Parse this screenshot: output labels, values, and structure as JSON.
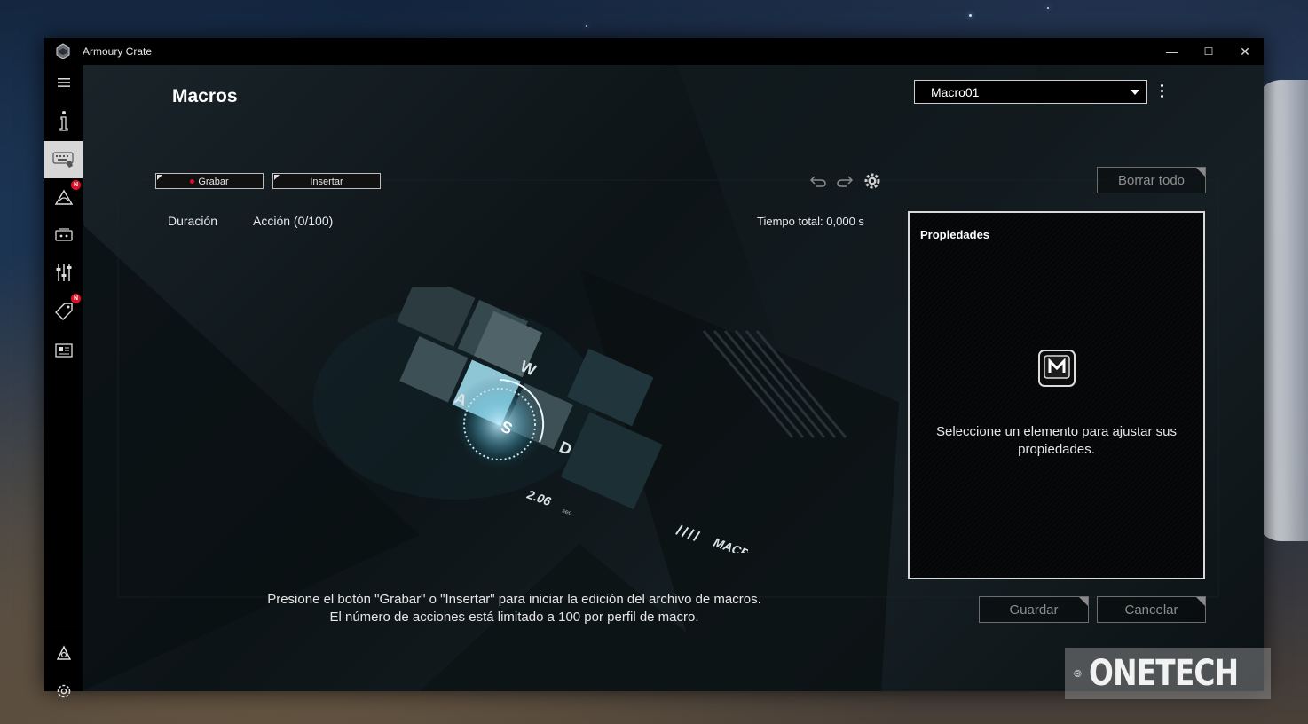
{
  "window": {
    "app_title": "Armoury Crate",
    "controls": {
      "minimize": "—",
      "maximize": "☐",
      "close": "✕"
    }
  },
  "sidebar": {
    "items": [
      {
        "icon": "hamburger-menu-icon"
      },
      {
        "icon": "device-info-icon"
      },
      {
        "icon": "keyboard-macro-icon",
        "active": true
      },
      {
        "icon": "aura-sync-icon",
        "badge": "N"
      },
      {
        "icon": "game-library-icon"
      },
      {
        "icon": "sliders-icon"
      },
      {
        "icon": "deals-tag-icon",
        "badge": "N"
      },
      {
        "icon": "news-icon"
      },
      {
        "icon": "user-center-icon"
      },
      {
        "icon": "settings-gear-icon"
      }
    ]
  },
  "page": {
    "title": "Macros",
    "profile_select": {
      "value": "Macro01"
    }
  },
  "toolbar": {
    "record_label": "Grabar",
    "insert_label": "Insertar",
    "clear_all_label": "Borrar todo"
  },
  "list": {
    "col_duration": "Duración",
    "col_action": "Acción (0/100)",
    "total_time": "Tiempo total: 0,000 s"
  },
  "illustration": {
    "keys": [
      "W",
      "A",
      "S",
      "D"
    ],
    "timer_text": "2.06",
    "timer_unit": "sec",
    "brand_text": "MACROS"
  },
  "properties": {
    "title": "Propiedades",
    "message": "Seleccione un elemento para ajustar sus propiedades."
  },
  "hint": {
    "line1": "Presione el botón  \"Grabar\" o \"Insertar\" para iniciar la edición del archivo de macros.",
    "line2": "El número de acciones está limitado a 100 por perfil de macro."
  },
  "actions": {
    "save_label": "Guardar",
    "cancel_label": "Cancelar"
  },
  "watermark": {
    "text": "ONETECH"
  },
  "colors": {
    "accent_red": "#e0102a",
    "window_bg": "#05080b",
    "text": "#e6e6e6"
  }
}
